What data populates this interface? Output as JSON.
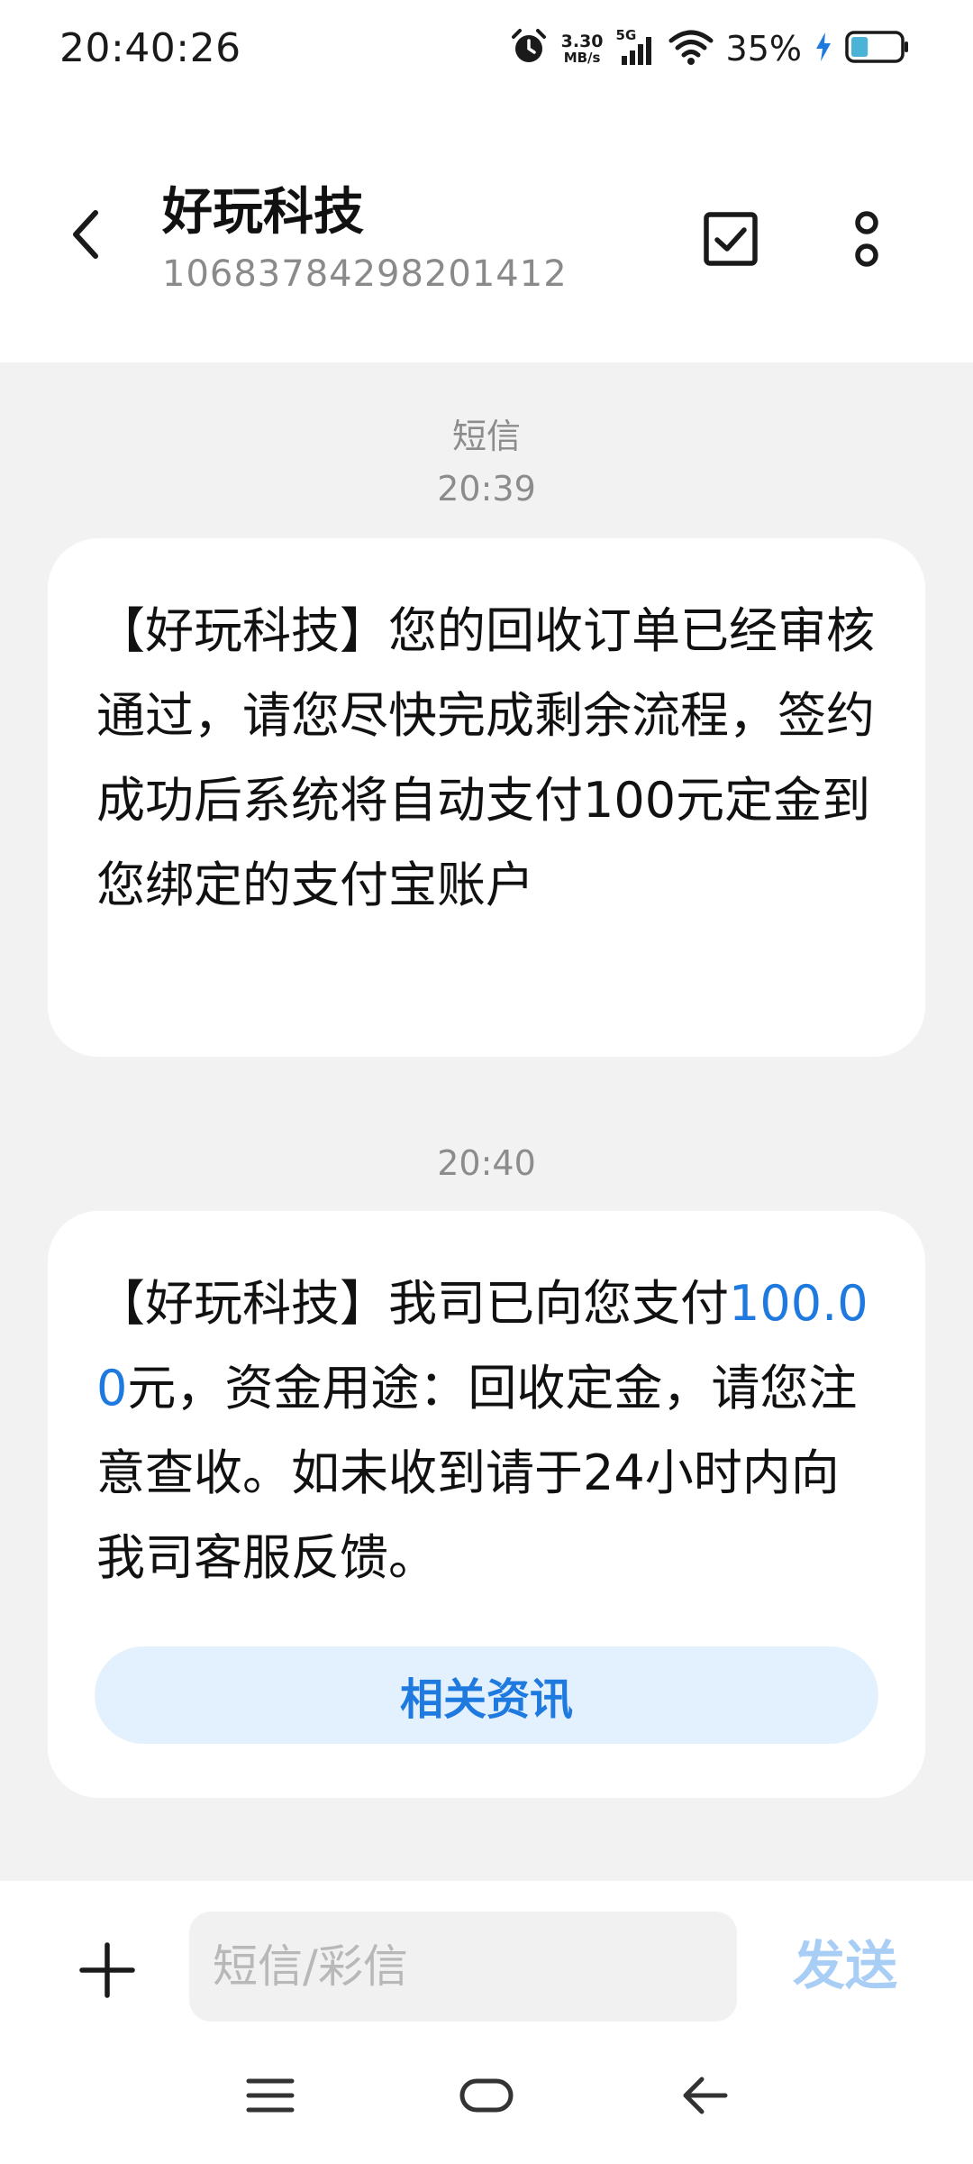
{
  "status_bar": {
    "time": "20:40:26",
    "net_speed_value": "3.30",
    "net_speed_unit": "MB/s",
    "network_type": "5G",
    "battery_percent": "35%",
    "battery_level": 0.35,
    "charging": true
  },
  "header": {
    "contact_name": "好玩科技",
    "contact_number": "10683784298201412"
  },
  "conversation": {
    "channel_label": "短信",
    "messages": [
      {
        "time": "20:39",
        "text": "【好玩科技】您的回收订单已经审核通过，请您尽快完成剩余流程，签约成功后系统将自动支付100元定金到您绑定的支付宝账户"
      },
      {
        "time": "20:40",
        "text_prefix": "【好玩科技】我司已向您支付",
        "amount": "100.00",
        "text_suffix": "元，资金用途：回收定金，请您注意查收。如未收到请于24小时内向我司客服反馈。",
        "action_label": "相关资讯"
      }
    ]
  },
  "composer": {
    "placeholder": "短信/彩信",
    "value": "",
    "send_label": "发送"
  },
  "colors": {
    "accent": "#1f7ae0",
    "send_disabled": "#a8cef5",
    "conversation_bg": "#f2f2f2"
  },
  "icons": {
    "back": "chevron-left-icon",
    "select": "checkbox-icon",
    "more": "more-vertical-icon",
    "add": "plus-icon",
    "nav_menu": "menu-icon",
    "nav_home": "home-icon",
    "nav_back": "back-arrow-icon"
  }
}
